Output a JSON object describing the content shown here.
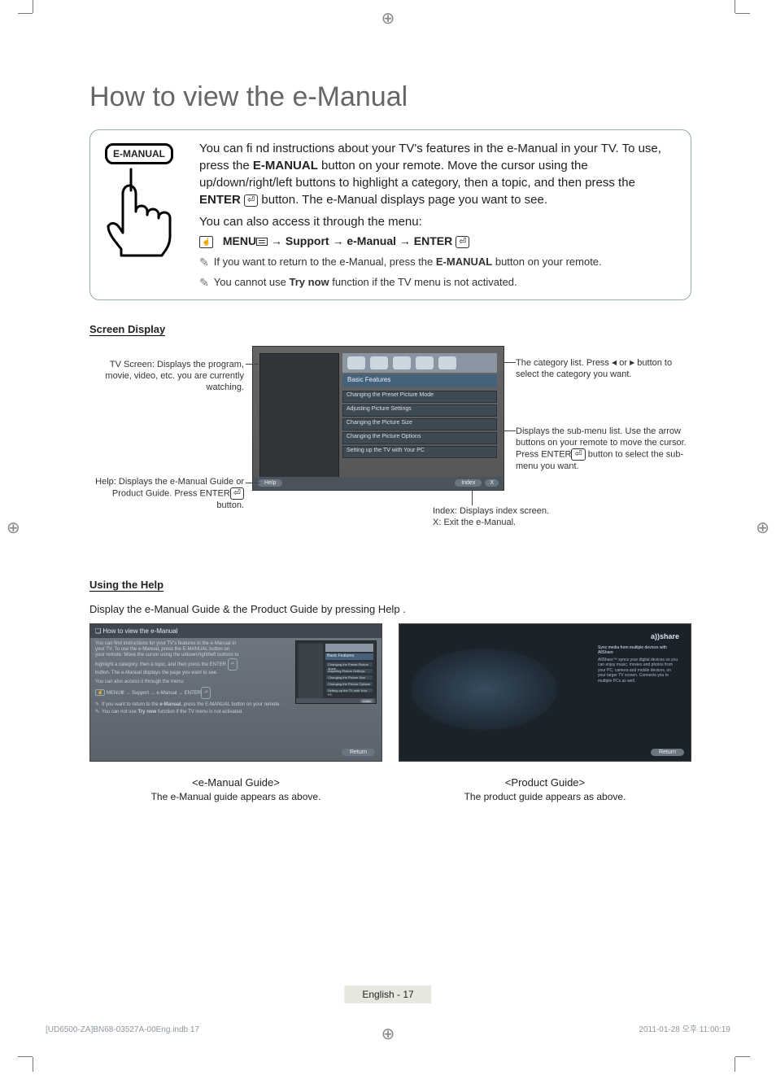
{
  "page": {
    "title": "How to view the e-Manual",
    "footer_label": "English - 17",
    "printfile_left": "[UD6500-ZA]BN68-03527A-00Eng.indb   17",
    "printfile_right": "2011-01-28   오후 11:00:19"
  },
  "emanual_button_label": "E-MANUAL",
  "intro": {
    "p1_a": "You can fi nd instructions about your TV's features in the e-Manual in your TV. To use, press the ",
    "p1_b": "E-MANUAL",
    "p1_c": " button on your remote. Move the cursor using the up/down/right/left buttons to highlight a category, then a topic, and then press the ",
    "p1_d": "ENTER",
    "p1_enter_glyph": "⏎",
    "p1_e": " button. The e-Manual displays page you want to see.",
    "p2": "You can also access it through the menu:",
    "menupath_a": "MENU",
    "menupath_m": "Ⅲ",
    "menupath_b": " → Support → e-Manual → ENTER",
    "note1_a": "If you want to return to the e-Manual, press the ",
    "note1_b": "E-MANUAL",
    "note1_c": " button on your remote.",
    "note2_a": "You cannot use ",
    "note2_b": "Try now",
    "note2_c": " function if the TV menu is not activated."
  },
  "screen_display": {
    "heading": "Screen Display",
    "cat_label": "Basic Features",
    "submenu": {
      "i0": "Changing the Preset Picture Mode",
      "i1": "Adjusting Picture Settings",
      "i2": "Changing the Picture Size",
      "i3": "Changing the Picture Options",
      "i4": "Setting up the TV with Your PC"
    },
    "help_pill": "Help",
    "index_pill": "Index",
    "x_pill": "X",
    "callout_tv_a": "TV Screen: Displays the program, movie, video, etc. you are currently watching.",
    "callout_cat_a": "The category list. Press ",
    "callout_cat_b": " or ",
    "callout_cat_c": " button to select the category you want.",
    "callout_sub_a": "Displays the sub-menu list. Use the arrow buttons on your remote to move the cursor. Press ",
    "callout_sub_b": "ENTER",
    "callout_sub_c": " button to select the sub-menu you want.",
    "callout_help_a": "Help",
    "callout_help_b": ": Displays the ",
    "callout_help_c": "e-Manual Guide",
    "callout_help_d": " or ",
    "callout_help_e": "Product Guide",
    "callout_help_f": ". Press ",
    "callout_help_g": "ENTER",
    "callout_help_h": " button.",
    "callout_idx_a": "Index",
    "callout_idx_b": ": Displays index screen.",
    "callout_x_a": "X",
    "callout_x_b": ": Exit the e-Manual."
  },
  "using_help": {
    "heading": "Using the Help",
    "lead_a": "Display the e-Manual Guide & the Product Guide by pressing ",
    "lead_b": "Help",
    "lead_c": ".",
    "card_title": "How to view the e-Manual",
    "card_body_a": "You can find instructions for your TV's features in the e-Manual in your TV. To use the e-Manual, press the E-MANUAL button on your remote. Move the cursor using the u/down/right/left buttons to highlight a category, then a topic, and then press the ENTER ",
    "card_body_b": " button. The e-Manual displays the page you want to see.",
    "card_p2": "You can also access it through the menu:",
    "card_menupath": "MENUⅢ → Support → e-Manual → ENTER",
    "card_note1": "If you want to return to the e-Manual, press the E-MANUAL button on your remote.",
    "card_note2": "You can not use Try now function if the TV menu is not activated.",
    "card_note1_bold": "e-Manual",
    "card_note2_bold": "Try now",
    "mini_cat": "Basic Features",
    "mini_rows": {
      "r0": "Changing the Preset Picture Mode",
      "r1": "Adjusting Picture Settings",
      "r2": "Changing the Picture Size",
      "r3": "Changing the Picture Options",
      "r4": "Setting up the TV with Your PC"
    },
    "mini_index": "Index",
    "return_label": "Return",
    "allshare_logo": "a))share",
    "allshare_head": "Sync media from multiple devices with AllShare",
    "allshare_text": "AllShare™ syncs your digital devices so you can enjoy music, movies and photos from your PC, camera and mobile devices, on your larger TV screen. Connects you to multiple PCs as well.",
    "cap_emanual_t": "<e-Manual Guide>",
    "cap_emanual_s": "The e-Manual guide appears as above.",
    "cap_product_t": "<Product Guide>",
    "cap_product_s": "The product guide appears as above."
  }
}
